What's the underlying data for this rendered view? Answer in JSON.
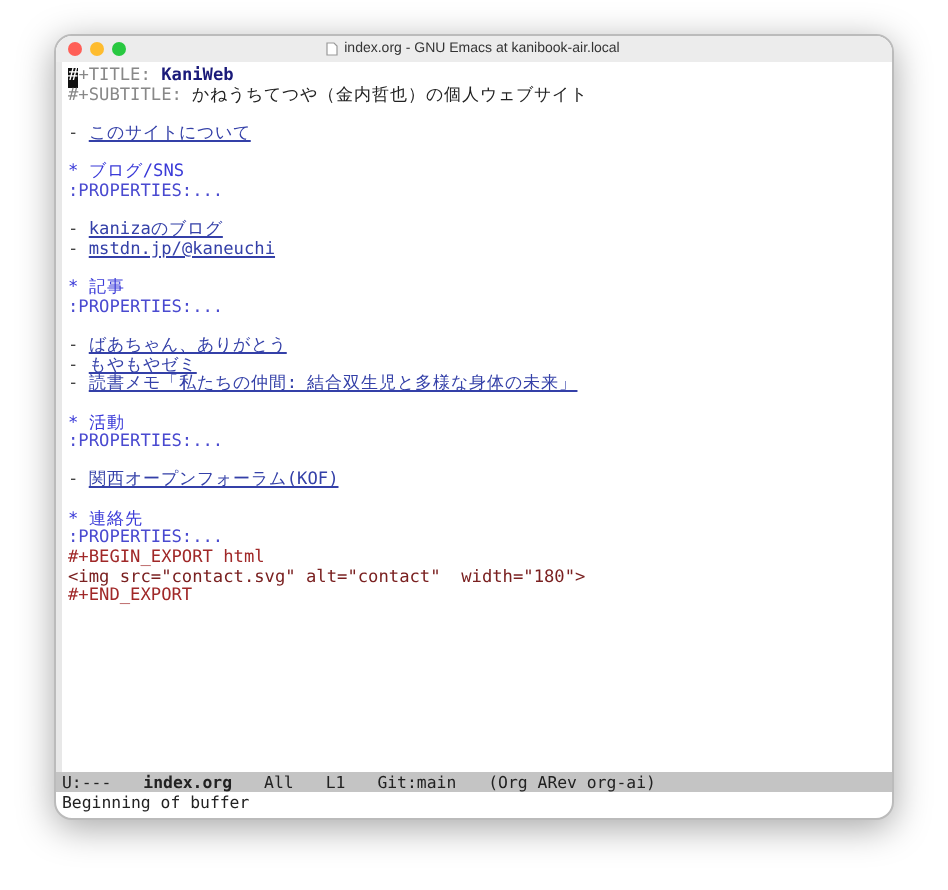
{
  "window": {
    "title": "index.org - GNU Emacs at kanibook-air.local"
  },
  "buffer": {
    "lines": [
      {
        "kind": "keyword",
        "key": "#+TITLE:",
        "value": "KaniWeb",
        "cursor": true
      },
      {
        "kind": "keyword",
        "key": "#+SUBTITLE:",
        "value": "かねうちてつや（金内哲也）の個人ウェブサイト",
        "cursor": false
      },
      {
        "kind": "blank"
      },
      {
        "kind": "link",
        "bullet": "-",
        "text": "このサイトについて"
      },
      {
        "kind": "blank"
      },
      {
        "kind": "heading",
        "star": "*",
        "text": "ブログ/SNS"
      },
      {
        "kind": "properties",
        "text": ":PROPERTIES:..."
      },
      {
        "kind": "blank"
      },
      {
        "kind": "link",
        "bullet": "-",
        "text": "kanizaのブログ"
      },
      {
        "kind": "link",
        "bullet": "-",
        "text": "mstdn.jp/@kaneuchi"
      },
      {
        "kind": "blank"
      },
      {
        "kind": "heading",
        "star": "*",
        "text": "記事"
      },
      {
        "kind": "properties",
        "text": ":PROPERTIES:..."
      },
      {
        "kind": "blank"
      },
      {
        "kind": "link",
        "bullet": "-",
        "text": "ばあちゃん、ありがとう"
      },
      {
        "kind": "link",
        "bullet": "-",
        "text": "もやもやゼミ"
      },
      {
        "kind": "link",
        "bullet": "-",
        "text": "読書メモ「私たちの仲間: 結合双生児と多様な身体の未来」"
      },
      {
        "kind": "blank"
      },
      {
        "kind": "heading",
        "star": "*",
        "text": "活動"
      },
      {
        "kind": "properties",
        "text": ":PROPERTIES:..."
      },
      {
        "kind": "blank"
      },
      {
        "kind": "link",
        "bullet": "-",
        "text": "関西オープンフォーラム(KOF)"
      },
      {
        "kind": "blank"
      },
      {
        "kind": "heading",
        "star": "*",
        "text": "連絡先"
      },
      {
        "kind": "properties",
        "text": ":PROPERTIES:..."
      },
      {
        "kind": "export",
        "text": "#+BEGIN_EXPORT html"
      },
      {
        "kind": "html",
        "text": "<img src=\"contact.svg\" alt=\"contact\"  width=\"180\">"
      },
      {
        "kind": "export",
        "text": "#+END_EXPORT"
      }
    ]
  },
  "mode_line": {
    "status": "U:---",
    "buffer_name": "index.org",
    "position": "All",
    "line": "L1",
    "vc": "Git:main",
    "modes": "(Org ARev org-ai)"
  },
  "echo_area": "Beginning of buffer"
}
